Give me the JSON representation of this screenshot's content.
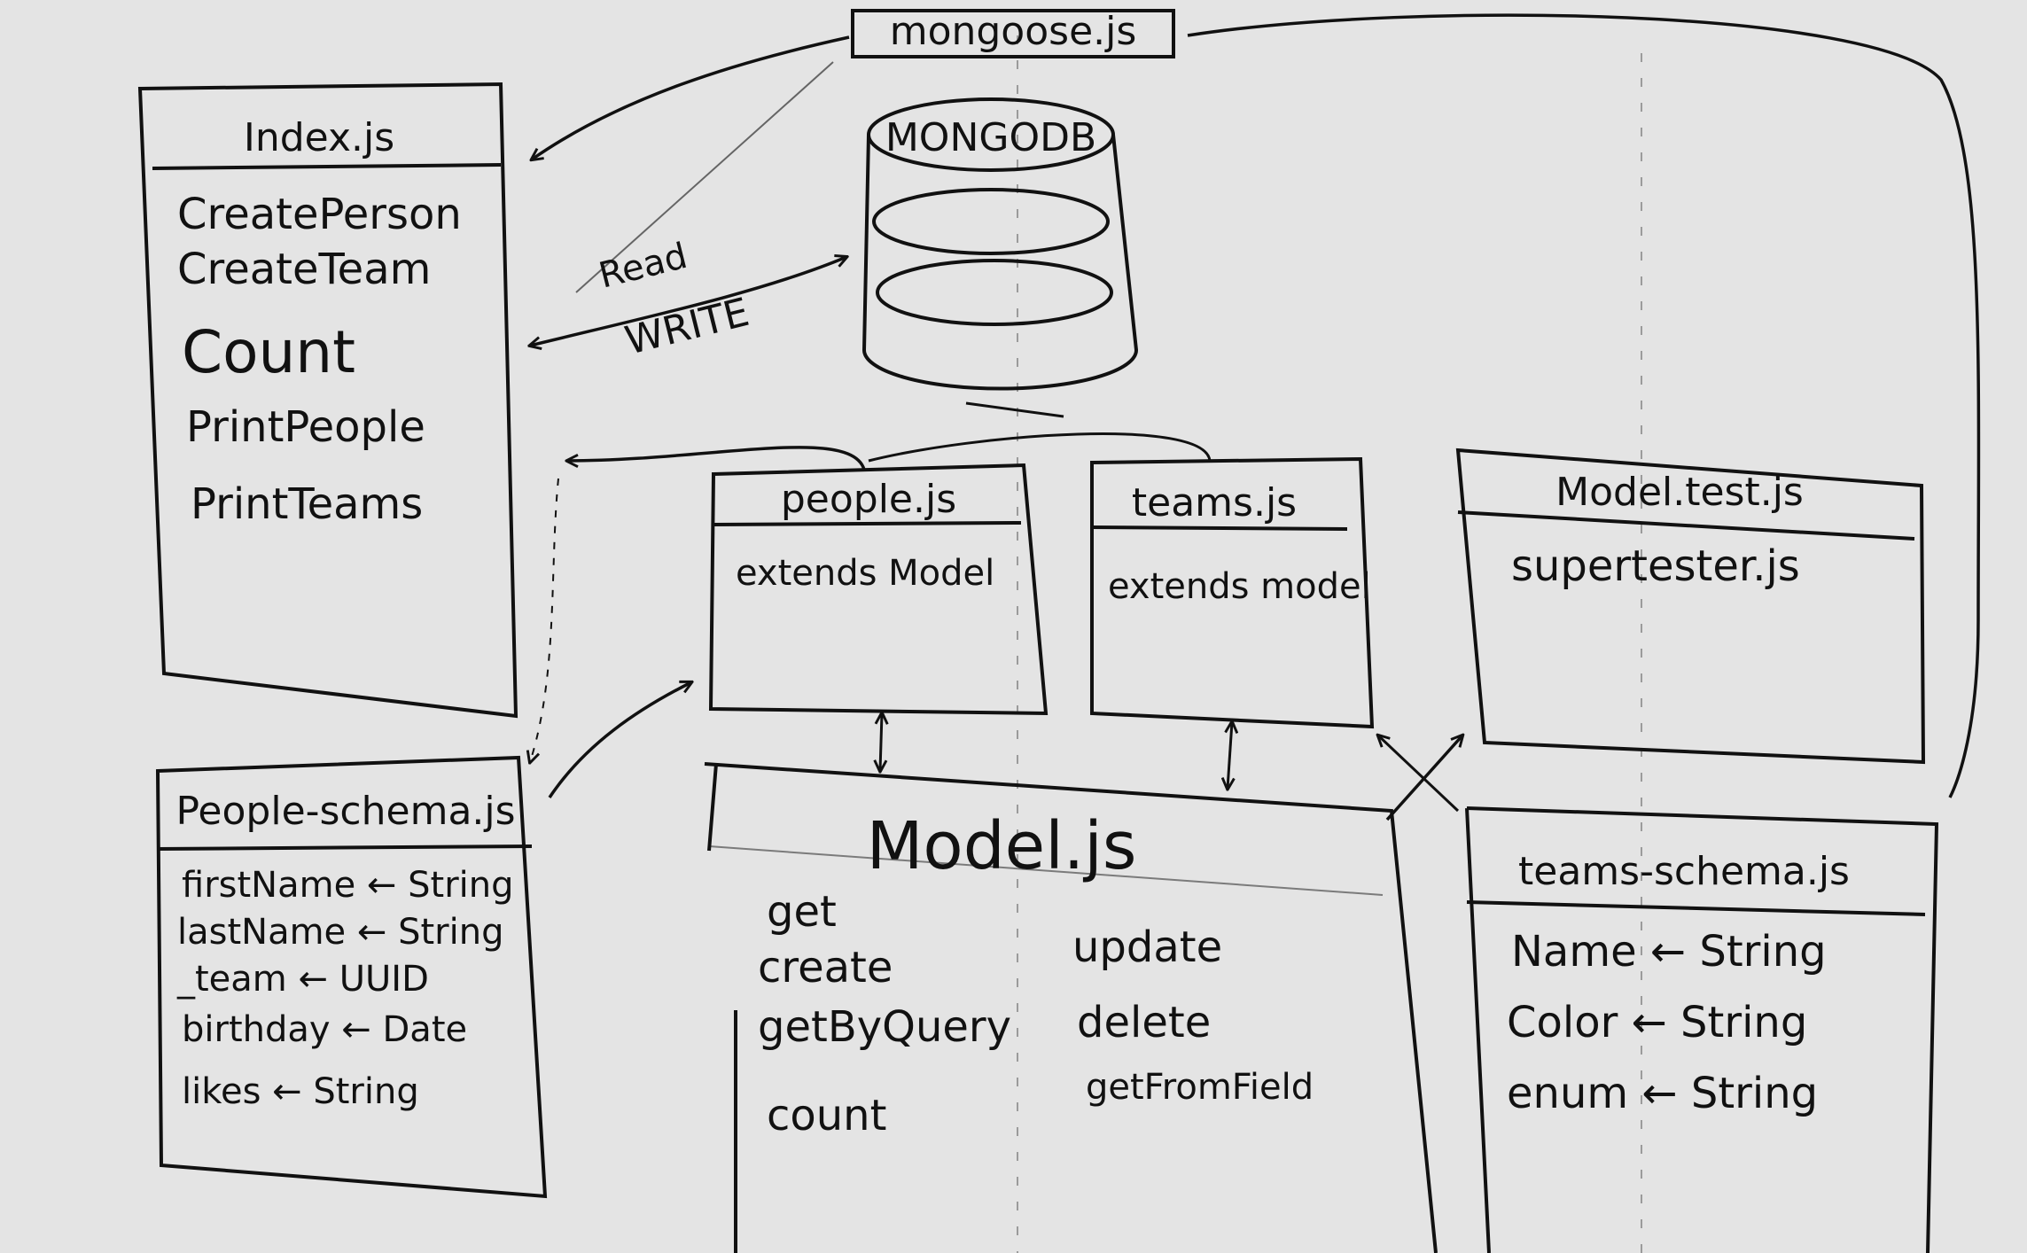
{
  "diagram": {
    "mongoose": {
      "title": "mongoose.js"
    },
    "database": {
      "label": "MONGODB"
    },
    "index": {
      "title": "Index.js",
      "items": [
        "CreatePerson",
        "CreateTeam",
        "Count",
        "PrintPeople",
        "PrintTeams"
      ]
    },
    "rw_arrow": {
      "read": "Read",
      "write": "WRITE"
    },
    "people": {
      "title": "people.js",
      "body": "extends Model"
    },
    "teams": {
      "title": "teams.js",
      "body": "extends model"
    },
    "model_test": {
      "title": "Model.test.js",
      "body": "supertester.js"
    },
    "people_schema": {
      "title": "People-schema.js",
      "fields": [
        "firstName ← String",
        "lastName ← String",
        "_team ← UUID",
        "birthday ← Date",
        "likes ← String"
      ]
    },
    "model": {
      "title": "Model.js",
      "left_methods": [
        "get",
        "create",
        "getByQuery",
        "count"
      ],
      "right_methods": [
        "update",
        "delete",
        "getFromField"
      ]
    },
    "teams_schema": {
      "title": "teams-schema.js",
      "fields": [
        "Name ← String",
        "Color ← String",
        "enum ← String"
      ]
    }
  },
  "colors": {
    "ink": "#111111",
    "board": "#e4e4e4"
  }
}
